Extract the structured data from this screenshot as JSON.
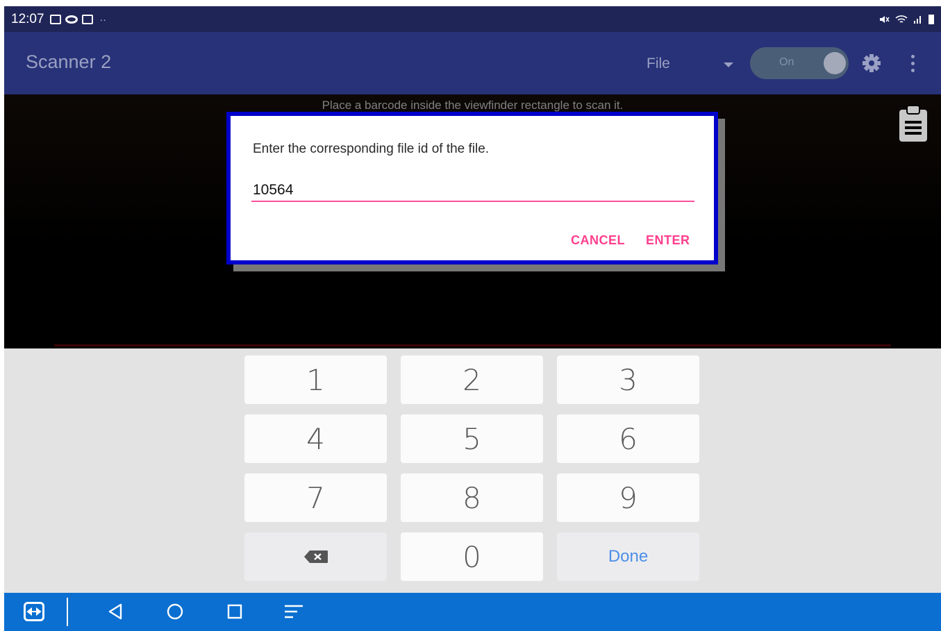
{
  "status_bar": {
    "time": "12:07",
    "more_indicator": "··",
    "icons_left": [
      "gallery-icon",
      "eye-icon",
      "teamviewer-icon"
    ],
    "icons_right": [
      "mute-icon",
      "wifi-icon",
      "signal-icon",
      "battery-icon"
    ]
  },
  "app_bar": {
    "title": "Scanner 2",
    "mode_dropdown": "File",
    "toggle_label": "On",
    "toggle_state": true
  },
  "camera": {
    "hint": "Place a barcode inside the viewfinder rectangle to scan it."
  },
  "dialog": {
    "message": "Enter the corresponding file id of the file.",
    "input_value": "10564",
    "cancel_label": "CANCEL",
    "enter_label": "ENTER"
  },
  "keypad": {
    "keys": [
      "1",
      "2",
      "3",
      "4",
      "5",
      "6",
      "7",
      "8",
      "9",
      "0"
    ],
    "done_label": "Done"
  },
  "nav_bar": {
    "icons": [
      "teamviewer-icon",
      "back-icon",
      "home-icon",
      "recents-icon",
      "menu-icon"
    ]
  },
  "colors": {
    "app_bar": "#283278",
    "status_bar": "#1f2557",
    "dialog_border": "#0000cc",
    "accent_pink": "#ff3f8e",
    "nav_bar": "#0a6fd1",
    "done_blue": "#4d8fe6"
  }
}
